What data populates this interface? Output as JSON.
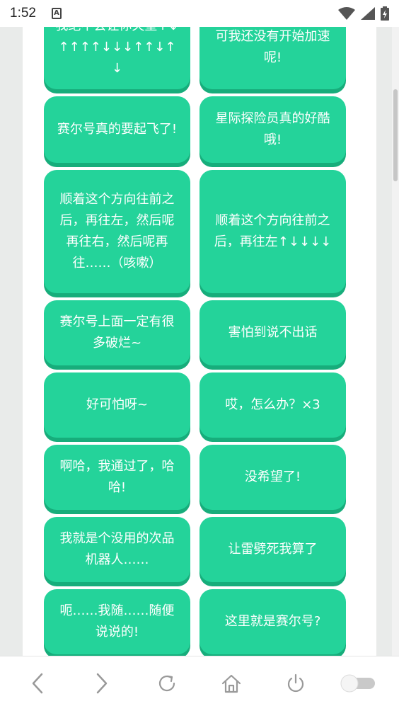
{
  "status": {
    "time": "1:52",
    "notification_icon": "A"
  },
  "cards": [
    {
      "label": "我绝不会让你失望↑↓↑↑↑↑↓↓↓↑↑↓↑↓"
    },
    {
      "label": "可我还没有开始加速呢!"
    },
    {
      "label": "赛尔号真的要起飞了!"
    },
    {
      "label": "星际探险员真的好酷哦!"
    },
    {
      "label": "顺着这个方向往前之后，再往左，然后呢再往右，然后呢再往……（咳嗽）"
    },
    {
      "label": "顺着这个方向往前之后，再往左↑↓↓↓↓"
    },
    {
      "label": "赛尔号上面一定有很多破烂~"
    },
    {
      "label": "害怕到说不出话"
    },
    {
      "label": "好可怕呀~"
    },
    {
      "label": "哎，怎么办？×3"
    },
    {
      "label": "啊哈，我通过了，哈哈!"
    },
    {
      "label": "没希望了!"
    },
    {
      "label": "我就是个没用的次品机器人……"
    },
    {
      "label": "让雷劈死我算了"
    },
    {
      "label": "呃……我随……随便说说的!"
    },
    {
      "label": "这里就是赛尔号?"
    }
  ],
  "navbar": {
    "back": "back-icon",
    "forward": "forward-icon",
    "reload": "reload-icon",
    "home": "home-icon",
    "power": "power-icon",
    "toggle": "toggle-switch"
  },
  "colors": {
    "card": "#24d39a",
    "card_shadow": "#17ad7b",
    "text": "#ffffff"
  }
}
